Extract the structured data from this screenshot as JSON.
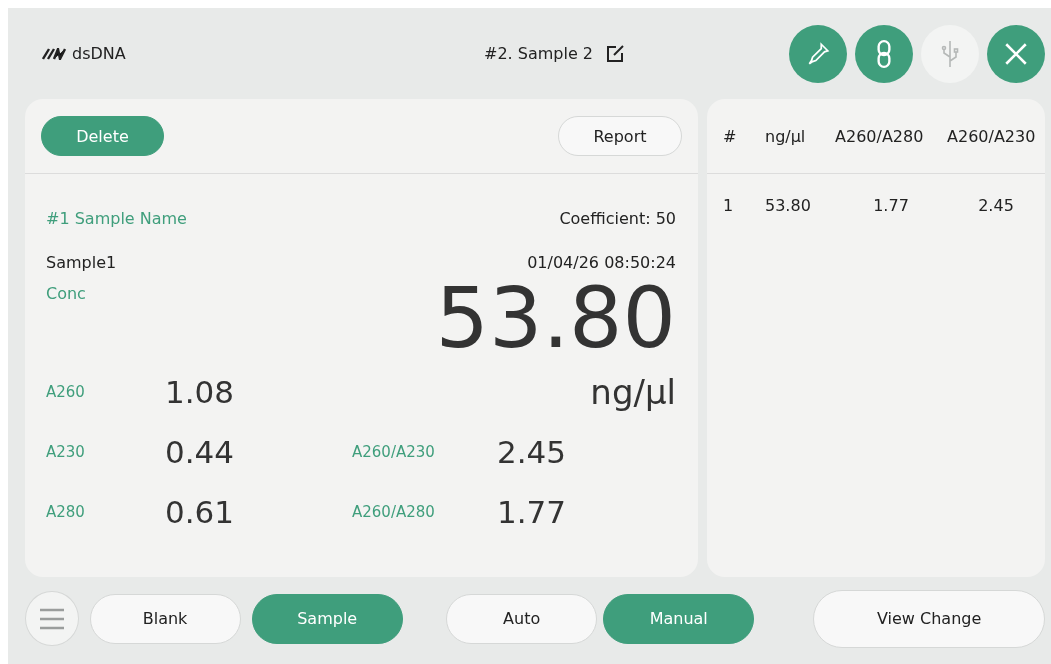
{
  "header": {
    "assay": "dsDNA",
    "sample_title": "#2. Sample 2",
    "actions": [
      {
        "kind": "pipette",
        "disabled": false
      },
      {
        "kind": "link",
        "disabled": false
      },
      {
        "kind": "usb",
        "disabled": true
      },
      {
        "kind": "close",
        "disabled": false
      }
    ]
  },
  "result": {
    "delete": "Delete",
    "report": "Report",
    "name_label": "#1 Sample Name",
    "coefficient": "Coefficient: 50",
    "sample_name": "Sample1",
    "timestamp": "01/04/26 08:50:24",
    "conc_label": "Conc",
    "conc_value": "53.80",
    "unit": "ng/µl",
    "metrics": [
      {
        "label": "A260",
        "value": "1.08"
      },
      {
        "label": "A230",
        "value": "0.44",
        "ratio_label": "A260/A230",
        "ratio_value": "2.45"
      },
      {
        "label": "A280",
        "value": "0.61",
        "ratio_label": "A260/A280",
        "ratio_value": "1.77"
      }
    ]
  },
  "table": {
    "columns": [
      "#",
      "ng/µl",
      "A260/A280",
      "A260/A230"
    ],
    "rows": [
      [
        "1",
        "53.80",
        "1.77",
        "2.45"
      ]
    ]
  },
  "bottom": {
    "mode_buttons": [
      {
        "label": "Blank",
        "selected": false
      },
      {
        "label": "Sample",
        "selected": true
      }
    ],
    "method_buttons": [
      {
        "label": "Auto",
        "selected": false
      },
      {
        "label": "Manual",
        "selected": true
      }
    ],
    "view_change": "View Change"
  }
}
